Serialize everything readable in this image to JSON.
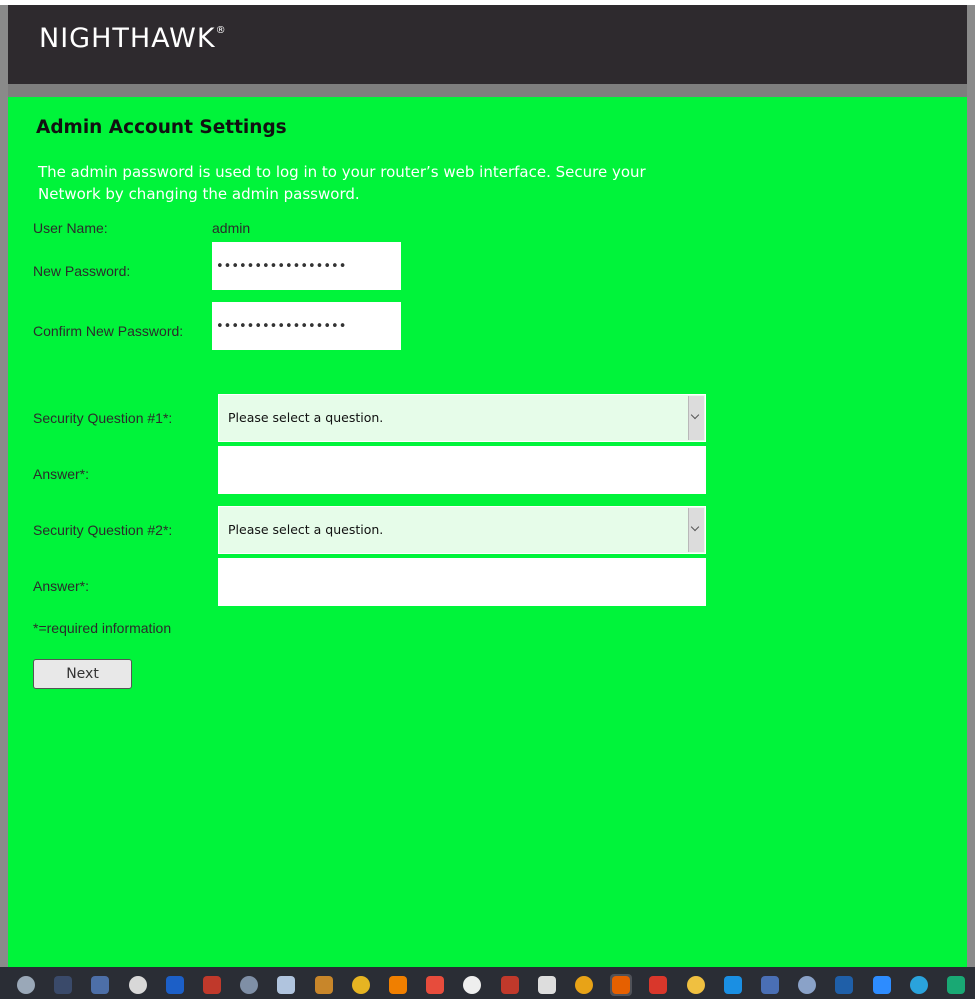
{
  "header": {
    "logo_text": "NIGHTHAWK",
    "logo_mark": "®"
  },
  "page": {
    "title": "Admin Account Settings",
    "intro": "The admin password is used to log in to your router’s web interface. Secure your Network by changing the admin password."
  },
  "form": {
    "username_label": "User Name:",
    "username_value": "admin",
    "new_password_label": "New Password:",
    "new_password_value": "•••••••••••••••••",
    "confirm_password_label": "Confirm New Password:",
    "confirm_password_value": "•••••••••••••••••",
    "question1_label": "Security Question #1*:",
    "question1_selected": "Please select a question.",
    "answer1_label": "Answer*:",
    "answer1_value": "",
    "question2_label": "Security Question #2*:",
    "question2_selected": "Please select a question.",
    "answer2_label": "Answer*:",
    "answer2_value": "",
    "required_note": "*=required information",
    "next_label": "Next"
  },
  "colors": {
    "header_bg": "#2e2a2e",
    "content_bg": "#00f43a",
    "select_bg": "#e6fce9",
    "taskbar_bg": "#2a2d35"
  },
  "taskbar": {
    "icons": [
      "system-monitor-icon",
      "speedometer-icon",
      "clock-icon",
      "gear-icon",
      "ccleaner-icon",
      "phone-transfer-icon",
      "paint-icon",
      "radar-icon",
      "bear-icon",
      "file-explorer-icon",
      "vlc-icon",
      "screen-recorder-icon",
      "video-editor-icon",
      "lips-icon",
      "obs-icon",
      "chrome-icon",
      "firefox-icon",
      "reader-icon",
      "game-icon",
      "skype-icon",
      "messenger-icon",
      "network-icon",
      "facebook-icon",
      "zoom-icon",
      "telegram-icon",
      "sync-icon"
    ]
  }
}
